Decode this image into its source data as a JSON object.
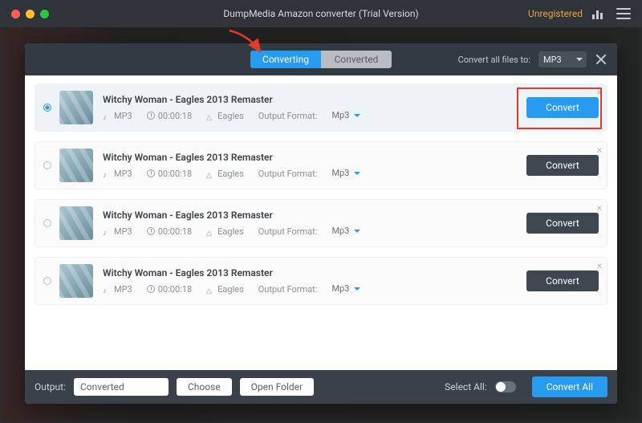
{
  "titlebar": {
    "title": "DumpMedia Amazon converter (Trial Version)",
    "unregistered": "Unregistered"
  },
  "panel": {
    "tabs": {
      "converting": "Converting",
      "converted": "Converted"
    },
    "convert_all_files_to": "Convert all files to:",
    "global_format": "MP3"
  },
  "tracks": [
    {
      "selected": true,
      "title": "Witchy Woman - Eagles 2013 Remaster",
      "format": "MP3",
      "duration": "00:00:18",
      "artist": "Eagles",
      "output_format_label": "Output Format:",
      "output_format": "Mp3",
      "convert_label": "Convert",
      "primary": true
    },
    {
      "selected": false,
      "title": "Witchy Woman - Eagles 2013 Remaster",
      "format": "MP3",
      "duration": "00:00:18",
      "artist": "Eagles",
      "output_format_label": "Output Format:",
      "output_format": "Mp3",
      "convert_label": "Convert",
      "primary": false
    },
    {
      "selected": false,
      "title": "Witchy Woman - Eagles 2013 Remaster",
      "format": "MP3",
      "duration": "00:00:18",
      "artist": "Eagles",
      "output_format_label": "Output Format:",
      "output_format": "Mp3",
      "convert_label": "Convert",
      "primary": false
    },
    {
      "selected": false,
      "title": "Witchy Woman - Eagles 2013 Remaster",
      "format": "MP3",
      "duration": "00:00:18",
      "artist": "Eagles",
      "output_format_label": "Output Format:",
      "output_format": "Mp3",
      "convert_label": "Convert",
      "primary": false
    }
  ],
  "footer": {
    "output_label": "Output:",
    "output_value": "Converted",
    "choose": "Choose",
    "open_folder": "Open Folder",
    "select_all": "Select All:",
    "convert_all": "Convert All"
  }
}
